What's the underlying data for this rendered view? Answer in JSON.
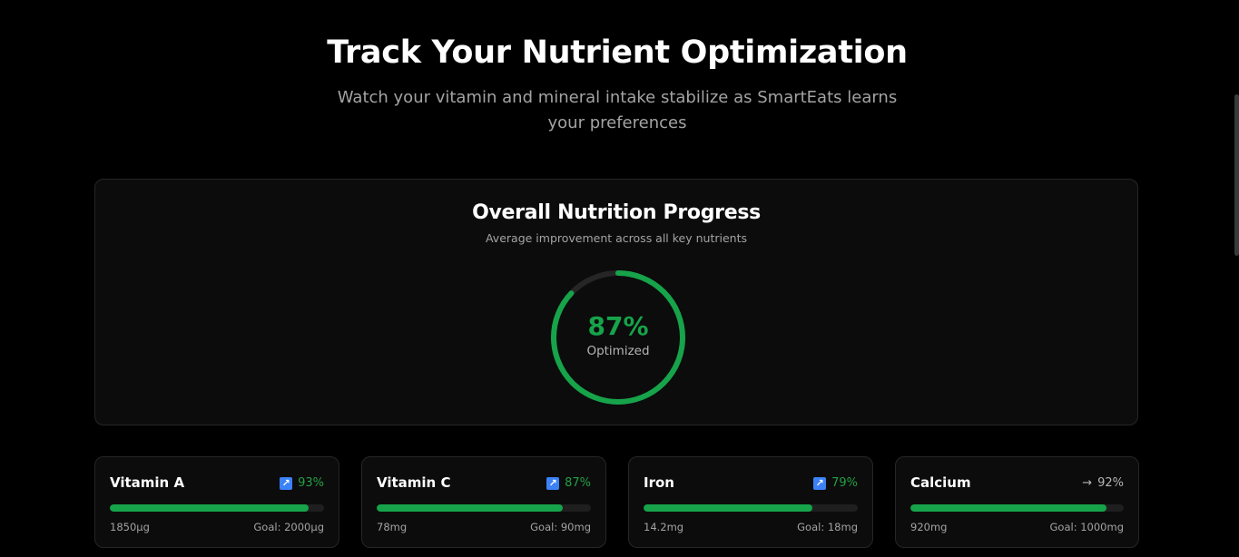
{
  "header": {
    "title": "Track Your Nutrient Optimization",
    "subtitle": "Watch your vitamin and mineral intake stabilize as SmartEats learns your preferences"
  },
  "overall": {
    "title": "Overall Nutrition Progress",
    "subtitle": "Average improvement across all key nutrients",
    "value_text": "87%",
    "value_fraction": 0.87,
    "label": "Optimized",
    "ring_color": "#16a34a",
    "track_color": "#262626"
  },
  "nutrients": [
    {
      "name": "Vitamin A",
      "trend_icon": "trend-up-icon",
      "percent_text": "93%",
      "fraction": 0.93,
      "current": "1850µg",
      "goal": "Goal: 2000µg"
    },
    {
      "name": "Vitamin C",
      "trend_icon": "trend-up-icon",
      "percent_text": "87%",
      "fraction": 0.87,
      "current": "78mg",
      "goal": "Goal: 90mg"
    },
    {
      "name": "Iron",
      "trend_icon": "trend-up-icon",
      "percent_text": "79%",
      "fraction": 0.79,
      "current": "14.2mg",
      "goal": "Goal: 18mg"
    },
    {
      "name": "Calcium",
      "trend_icon": "arrow-right-icon",
      "trend_glyph": "→",
      "percent_text": "92%",
      "fraction": 0.92,
      "current": "920mg",
      "goal": "Goal: 1000mg"
    }
  ],
  "colors": {
    "accent_green": "#16a34a",
    "trend_blue": "#3b82f6",
    "background": "#000000",
    "card": "#0c0c0c"
  }
}
